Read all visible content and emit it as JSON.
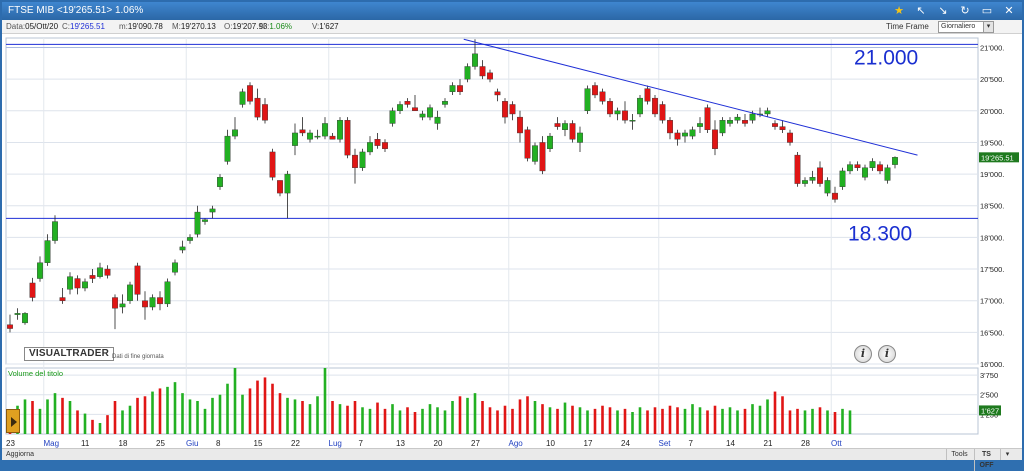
{
  "window": {
    "title": "FTSE MIB  <19'265.51>  1.06%",
    "icons": [
      "star-icon",
      "arrow-up-icon",
      "arrow-down-icon",
      "refresh-icon",
      "window-icon",
      "close-icon"
    ]
  },
  "infobar": {
    "date_label": "Data:",
    "date": "05/Ott/20",
    "close_label": "C:",
    "close": "19'265.51",
    "min_label": "m:",
    "min": "19'090.78",
    "max_label": "M:",
    "max": "19'270.13",
    "open_label": "O:",
    "open": "19'207.93",
    "pct_label": "%:",
    "pct": "1.06%",
    "vol_label": "V:",
    "vol": "1'627",
    "timeframe_label": "Time Frame",
    "timeframe_value": "Giornaliero"
  },
  "branding": {
    "logo": "VISUALTRADER",
    "subtitle": "Dati di fine giornata"
  },
  "annotations": {
    "resistance_label": "21.000",
    "support_label": "18.300"
  },
  "volume_label": "Volume del titolo",
  "bottombar": {
    "update": "Aggiorna",
    "tools": "Tools",
    "ts": "TS OFF"
  },
  "colors": {
    "up": "#22b022",
    "down": "#e01515",
    "trendline": "#1f2fd6",
    "support": "#1f2fd6",
    "accent": "#2b67a6"
  },
  "chart_data": {
    "type": "candlestick",
    "price_axis": {
      "ylim": [
        16000,
        21150
      ],
      "ticks": [
        16000,
        16500,
        17000,
        17500,
        18000,
        18500,
        19000,
        19500,
        20000,
        20500,
        21000
      ],
      "tick_labels": [
        "16'000.",
        "16'500.",
        "17'000.",
        "17'500.",
        "18'000.",
        "18'500.",
        "19'000.",
        "19'500.",
        "20'000.",
        "20'500.",
        "21'000."
      ],
      "last_price_label": "19'265.51"
    },
    "volume_axis": {
      "ylim": [
        0,
        4200
      ],
      "ticks": [
        1250,
        2500,
        3750
      ],
      "tick_labels": [
        "1'250",
        "2'500",
        "3'750"
      ],
      "last_volume_label": "1'627"
    },
    "x_labels": [
      {
        "i": 0,
        "label": "23",
        "month": false
      },
      {
        "i": 5,
        "label": "Mag",
        "month": true
      },
      {
        "i": 10,
        "label": "11",
        "month": false
      },
      {
        "i": 15,
        "label": "18",
        "month": false
      },
      {
        "i": 20,
        "label": "25",
        "month": false
      },
      {
        "i": 24,
        "label": "Giu",
        "month": true
      },
      {
        "i": 28,
        "label": "8",
        "month": false
      },
      {
        "i": 33,
        "label": "15",
        "month": false
      },
      {
        "i": 38,
        "label": "22",
        "month": false
      },
      {
        "i": 43,
        "label": "Lug",
        "month": true
      },
      {
        "i": 47,
        "label": "7",
        "month": false
      },
      {
        "i": 52,
        "label": "13",
        "month": false
      },
      {
        "i": 57,
        "label": "20",
        "month": false
      },
      {
        "i": 62,
        "label": "27",
        "month": false
      },
      {
        "i": 67,
        "label": "Ago",
        "month": true
      },
      {
        "i": 72,
        "label": "10",
        "month": false
      },
      {
        "i": 77,
        "label": "17",
        "month": false
      },
      {
        "i": 82,
        "label": "24",
        "month": false
      },
      {
        "i": 87,
        "label": "Set",
        "month": true
      },
      {
        "i": 91,
        "label": "7",
        "month": false
      },
      {
        "i": 96,
        "label": "14",
        "month": false
      },
      {
        "i": 101,
        "label": "21",
        "month": false
      },
      {
        "i": 106,
        "label": "28",
        "month": false
      },
      {
        "i": 110,
        "label": "Ott",
        "month": true
      }
    ],
    "resistance_level": 21050,
    "support_level": 18300,
    "trendline": {
      "from": {
        "i": 60.5,
        "price": 21130
      },
      "to": {
        "i": 121,
        "price": 19300
      }
    },
    "candles": [
      {
        "o": 16620,
        "h": 16780,
        "l": 16500,
        "c": 16560
      },
      {
        "o": 16780,
        "h": 16880,
        "l": 16700,
        "c": 16800
      },
      {
        "o": 16650,
        "h": 16820,
        "l": 16620,
        "c": 16800
      },
      {
        "o": 17280,
        "h": 17360,
        "l": 16990,
        "c": 17050
      },
      {
        "o": 17350,
        "h": 17700,
        "l": 17300,
        "c": 17600
      },
      {
        "o": 17600,
        "h": 18050,
        "l": 17550,
        "c": 17950
      },
      {
        "o": 17950,
        "h": 18350,
        "l": 17900,
        "c": 18250
      },
      {
        "o": 17050,
        "h": 17200,
        "l": 16950,
        "c": 17000
      },
      {
        "o": 17180,
        "h": 17450,
        "l": 17100,
        "c": 17380
      },
      {
        "o": 17350,
        "h": 17400,
        "l": 17100,
        "c": 17200
      },
      {
        "o": 17200,
        "h": 17350,
        "l": 17150,
        "c": 17300
      },
      {
        "o": 17400,
        "h": 17500,
        "l": 17280,
        "c": 17350
      },
      {
        "o": 17380,
        "h": 17600,
        "l": 17350,
        "c": 17520
      },
      {
        "o": 17500,
        "h": 17560,
        "l": 17350,
        "c": 17400
      },
      {
        "o": 17050,
        "h": 17100,
        "l": 16550,
        "c": 16880
      },
      {
        "o": 16900,
        "h": 17100,
        "l": 16800,
        "c": 16950
      },
      {
        "o": 17000,
        "h": 17300,
        "l": 16950,
        "c": 17250
      },
      {
        "o": 17550,
        "h": 17600,
        "l": 17000,
        "c": 17100
      },
      {
        "o": 17000,
        "h": 17150,
        "l": 16700,
        "c": 16900
      },
      {
        "o": 16900,
        "h": 17100,
        "l": 16850,
        "c": 17050
      },
      {
        "o": 17050,
        "h": 17150,
        "l": 16850,
        "c": 16950
      },
      {
        "o": 16950,
        "h": 17350,
        "l": 16900,
        "c": 17300
      },
      {
        "o": 17450,
        "h": 17650,
        "l": 17400,
        "c": 17600
      },
      {
        "o": 17800,
        "h": 17950,
        "l": 17750,
        "c": 17850
      },
      {
        "o": 17950,
        "h": 18050,
        "l": 17900,
        "c": 18000
      },
      {
        "o": 18050,
        "h": 18500,
        "l": 18000,
        "c": 18400
      },
      {
        "o": 18250,
        "h": 18300,
        "l": 18200,
        "c": 18280
      },
      {
        "o": 18400,
        "h": 18500,
        "l": 18300,
        "c": 18450
      },
      {
        "o": 18800,
        "h": 19000,
        "l": 18750,
        "c": 18950
      },
      {
        "o": 19200,
        "h": 19700,
        "l": 19150,
        "c": 19600
      },
      {
        "o": 19600,
        "h": 19900,
        "l": 19550,
        "c": 19700
      },
      {
        "o": 20100,
        "h": 20350,
        "l": 20050,
        "c": 20300
      },
      {
        "o": 20400,
        "h": 20450,
        "l": 20100,
        "c": 20150
      },
      {
        "o": 20200,
        "h": 20350,
        "l": 19850,
        "c": 19900
      },
      {
        "o": 20100,
        "h": 20200,
        "l": 19800,
        "c": 19850
      },
      {
        "o": 19350,
        "h": 19400,
        "l": 18900,
        "c": 18950
      },
      {
        "o": 18900,
        "h": 18900,
        "l": 18650,
        "c": 18700
      },
      {
        "o": 18700,
        "h": 19050,
        "l": 18300,
        "c": 19000
      },
      {
        "o": 19450,
        "h": 19800,
        "l": 19300,
        "c": 19650
      },
      {
        "o": 19700,
        "h": 19900,
        "l": 19600,
        "c": 19650
      },
      {
        "o": 19550,
        "h": 19700,
        "l": 19500,
        "c": 19650
      },
      {
        "o": 19600,
        "h": 19700,
        "l": 19550,
        "c": 19600
      },
      {
        "o": 19600,
        "h": 19900,
        "l": 19550,
        "c": 19800
      },
      {
        "o": 19600,
        "h": 19650,
        "l": 19550,
        "c": 19550
      },
      {
        "o": 19550,
        "h": 19900,
        "l": 19500,
        "c": 19850
      },
      {
        "o": 19850,
        "h": 19900,
        "l": 19250,
        "c": 19300
      },
      {
        "o": 19300,
        "h": 19400,
        "l": 18850,
        "c": 19100
      },
      {
        "o": 19100,
        "h": 19400,
        "l": 19050,
        "c": 19350
      },
      {
        "o": 19350,
        "h": 19600,
        "l": 19300,
        "c": 19500
      },
      {
        "o": 19550,
        "h": 19650,
        "l": 19400,
        "c": 19450
      },
      {
        "o": 19500,
        "h": 19550,
        "l": 19350,
        "c": 19400
      },
      {
        "o": 19800,
        "h": 20050,
        "l": 19750,
        "c": 20000
      },
      {
        "o": 20000,
        "h": 20150,
        "l": 19950,
        "c": 20100
      },
      {
        "o": 20150,
        "h": 20200,
        "l": 20050,
        "c": 20100
      },
      {
        "o": 20050,
        "h": 20250,
        "l": 20000,
        "c": 20000
      },
      {
        "o": 19900,
        "h": 20000,
        "l": 19850,
        "c": 19950
      },
      {
        "o": 19900,
        "h": 20100,
        "l": 19850,
        "c": 20050
      },
      {
        "o": 19800,
        "h": 20000,
        "l": 19700,
        "c": 19900
      },
      {
        "o": 20100,
        "h": 20200,
        "l": 20050,
        "c": 20150
      },
      {
        "o": 20300,
        "h": 20450,
        "l": 20250,
        "c": 20400
      },
      {
        "o": 20400,
        "h": 20500,
        "l": 20250,
        "c": 20300
      },
      {
        "o": 20500,
        "h": 20750,
        "l": 20450,
        "c": 20700
      },
      {
        "o": 20700,
        "h": 21130,
        "l": 20650,
        "c": 20900
      },
      {
        "o": 20700,
        "h": 20800,
        "l": 20500,
        "c": 20550
      },
      {
        "o": 20600,
        "h": 20650,
        "l": 20450,
        "c": 20500
      },
      {
        "o": 20300,
        "h": 20350,
        "l": 20150,
        "c": 20250
      },
      {
        "o": 20150,
        "h": 20200,
        "l": 19800,
        "c": 19900
      },
      {
        "o": 20100,
        "h": 20150,
        "l": 19850,
        "c": 19950
      },
      {
        "o": 19900,
        "h": 20000,
        "l": 19500,
        "c": 19650
      },
      {
        "o": 19700,
        "h": 19750,
        "l": 19200,
        "c": 19250
      },
      {
        "o": 19200,
        "h": 19500,
        "l": 19150,
        "c": 19450
      },
      {
        "o": 19500,
        "h": 19600,
        "l": 19000,
        "c": 19050
      },
      {
        "o": 19400,
        "h": 19650,
        "l": 19350,
        "c": 19600
      },
      {
        "o": 19800,
        "h": 19900,
        "l": 19700,
        "c": 19750
      },
      {
        "o": 19700,
        "h": 19850,
        "l": 19600,
        "c": 19800
      },
      {
        "o": 19800,
        "h": 19850,
        "l": 19500,
        "c": 19550
      },
      {
        "o": 19500,
        "h": 19750,
        "l": 19350,
        "c": 19650
      },
      {
        "o": 20000,
        "h": 20400,
        "l": 19950,
        "c": 20350
      },
      {
        "o": 20400,
        "h": 20450,
        "l": 20200,
        "c": 20250
      },
      {
        "o": 20300,
        "h": 20350,
        "l": 20100,
        "c": 20150
      },
      {
        "o": 20150,
        "h": 20200,
        "l": 19900,
        "c": 19950
      },
      {
        "o": 19950,
        "h": 20050,
        "l": 19850,
        "c": 20000
      },
      {
        "o": 20000,
        "h": 20150,
        "l": 19800,
        "c": 19850
      },
      {
        "o": 19850,
        "h": 19950,
        "l": 19700,
        "c": 19850
      },
      {
        "o": 19950,
        "h": 20250,
        "l": 19900,
        "c": 20200
      },
      {
        "o": 20350,
        "h": 20400,
        "l": 20100,
        "c": 20150
      },
      {
        "o": 20200,
        "h": 20250,
        "l": 19900,
        "c": 19950
      },
      {
        "o": 20100,
        "h": 20150,
        "l": 19800,
        "c": 19850
      },
      {
        "o": 19850,
        "h": 19900,
        "l": 19550,
        "c": 19650
      },
      {
        "o": 19650,
        "h": 19700,
        "l": 19450,
        "c": 19550
      },
      {
        "o": 19600,
        "h": 19700,
        "l": 19500,
        "c": 19650
      },
      {
        "o": 19600,
        "h": 19750,
        "l": 19550,
        "c": 19700
      },
      {
        "o": 19750,
        "h": 19900,
        "l": 19650,
        "c": 19800
      },
      {
        "o": 20050,
        "h": 20100,
        "l": 19650,
        "c": 19700
      },
      {
        "o": 19700,
        "h": 19850,
        "l": 19300,
        "c": 19400
      },
      {
        "o": 19650,
        "h": 19900,
        "l": 19600,
        "c": 19850
      },
      {
        "o": 19800,
        "h": 19900,
        "l": 19750,
        "c": 19850
      },
      {
        "o": 19850,
        "h": 19950,
        "l": 19800,
        "c": 19900
      },
      {
        "o": 19850,
        "h": 19950,
        "l": 19750,
        "c": 19800
      },
      {
        "o": 19850,
        "h": 20000,
        "l": 19800,
        "c": 19950
      },
      {
        "o": 19950,
        "h": 20050,
        "l": 19900,
        "c": 19950
      },
      {
        "o": 19950,
        "h": 20050,
        "l": 19900,
        "c": 20000
      },
      {
        "o": 19800,
        "h": 19850,
        "l": 19700,
        "c": 19750
      },
      {
        "o": 19750,
        "h": 19850,
        "l": 19650,
        "c": 19700
      },
      {
        "o": 19650,
        "h": 19700,
        "l": 19450,
        "c": 19500
      },
      {
        "o": 19300,
        "h": 19350,
        "l": 18800,
        "c": 18850
      },
      {
        "o": 18850,
        "h": 18950,
        "l": 18800,
        "c": 18900
      },
      {
        "o": 18900,
        "h": 19050,
        "l": 18850,
        "c": 18950
      },
      {
        "o": 19100,
        "h": 19200,
        "l": 18800,
        "c": 18850
      },
      {
        "o": 18700,
        "h": 18950,
        "l": 18650,
        "c": 18900
      },
      {
        "o": 18700,
        "h": 18800,
        "l": 18550,
        "c": 18600
      },
      {
        "o": 18800,
        "h": 19100,
        "l": 18750,
        "c": 19050
      },
      {
        "o": 19050,
        "h": 19200,
        "l": 19000,
        "c": 19150
      },
      {
        "o": 19150,
        "h": 19200,
        "l": 19050,
        "c": 19100
      },
      {
        "o": 18950,
        "h": 19150,
        "l": 18900,
        "c": 19100
      },
      {
        "o": 19100,
        "h": 19250,
        "l": 19050,
        "c": 19200
      },
      {
        "o": 19150,
        "h": 19200,
        "l": 19000,
        "c": 19050
      },
      {
        "o": 18900,
        "h": 19150,
        "l": 18850,
        "c": 19100
      },
      {
        "o": 19150,
        "h": 19280,
        "l": 19090,
        "c": 19265
      }
    ],
    "volume": [
      900,
      1800,
      2200,
      2100,
      1600,
      2200,
      2600,
      2300,
      2100,
      1500,
      1300,
      900,
      700,
      1200,
      2100,
      1500,
      1800,
      2300,
      2400,
      2700,
      2900,
      3000,
      3300,
      2600,
      2200,
      2100,
      1600,
      2300,
      2500,
      3200,
      4200,
      2500,
      2900,
      3400,
      3600,
      3200,
      2600,
      2300,
      2200,
      2100,
      1900,
      2400,
      4200,
      2100,
      1900,
      1800,
      2100,
      1700,
      1600,
      2000,
      1600,
      1900,
      1500,
      1700,
      1400,
      1600,
      1900,
      1700,
      1500,
      2100,
      2400,
      2300,
      2600,
      2100,
      1700,
      1500,
      1800,
      1600,
      2200,
      2400,
      2100,
      1900,
      1700,
      1600,
      2000,
      1800,
      1700,
      1500,
      1600,
      1800,
      1700,
      1500,
      1600,
      1400,
      1700,
      1500,
      1700,
      1600,
      1800,
      1700,
      1600,
      1900,
      1700,
      1500,
      1800,
      1600,
      1700,
      1500,
      1600,
      1900,
      1800,
      2200,
      2700,
      2400,
      1500,
      1600,
      1500,
      1600,
      1700,
      1500,
      1400,
      1600,
      1500
    ]
  }
}
